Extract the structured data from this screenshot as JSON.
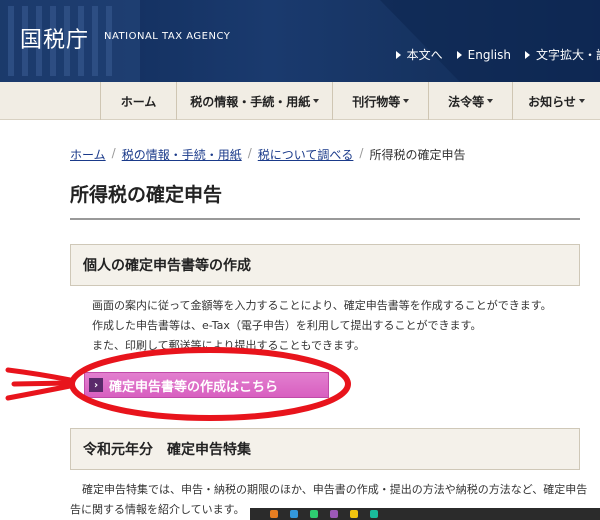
{
  "header": {
    "logo": "国税庁",
    "logo_en": "NATIONAL TAX AGENCY",
    "util_links": [
      {
        "label": "本文へ"
      },
      {
        "label": "English"
      },
      {
        "label": "文字拡大・読"
      }
    ]
  },
  "nav": {
    "items": [
      {
        "label": "ホーム",
        "has_menu": false
      },
      {
        "label": "税の情報・手続・用紙",
        "has_menu": true
      },
      {
        "label": "刊行物等",
        "has_menu": true
      },
      {
        "label": "法令等",
        "has_menu": true
      },
      {
        "label": "お知らせ",
        "has_menu": true
      }
    ]
  },
  "breadcrumb": {
    "items": [
      "ホーム",
      "税の情報・手続・用紙",
      "税について調べる"
    ],
    "current": "所得税の確定申告"
  },
  "page": {
    "title": "所得税の確定申告",
    "section1": {
      "heading": "個人の確定申告書等の作成",
      "lines": [
        "画面の案内に従って金額等を入力することにより、確定申告書等を作成することができます。",
        "作成した申告書等は、e-Tax（電子申告）を利用して提出することができます。",
        "また、印刷して郵送等により提出することもできます。"
      ],
      "cta": "確定申告書等の作成はこちら"
    },
    "section2": {
      "heading": "令和元年分　確定申告特集",
      "lines": [
        "確定申告特集では、申告・納税の期限のほか、申告書の作成・提出の方法や納税の方法など、確定申告",
        "告に関する情報を紹介しています。"
      ]
    }
  },
  "colors": {
    "header_bg": "#1a3a6e",
    "nav_bg": "#f1ede4",
    "cta_bg": "#d85fc0",
    "annotation": "#e8141c"
  }
}
